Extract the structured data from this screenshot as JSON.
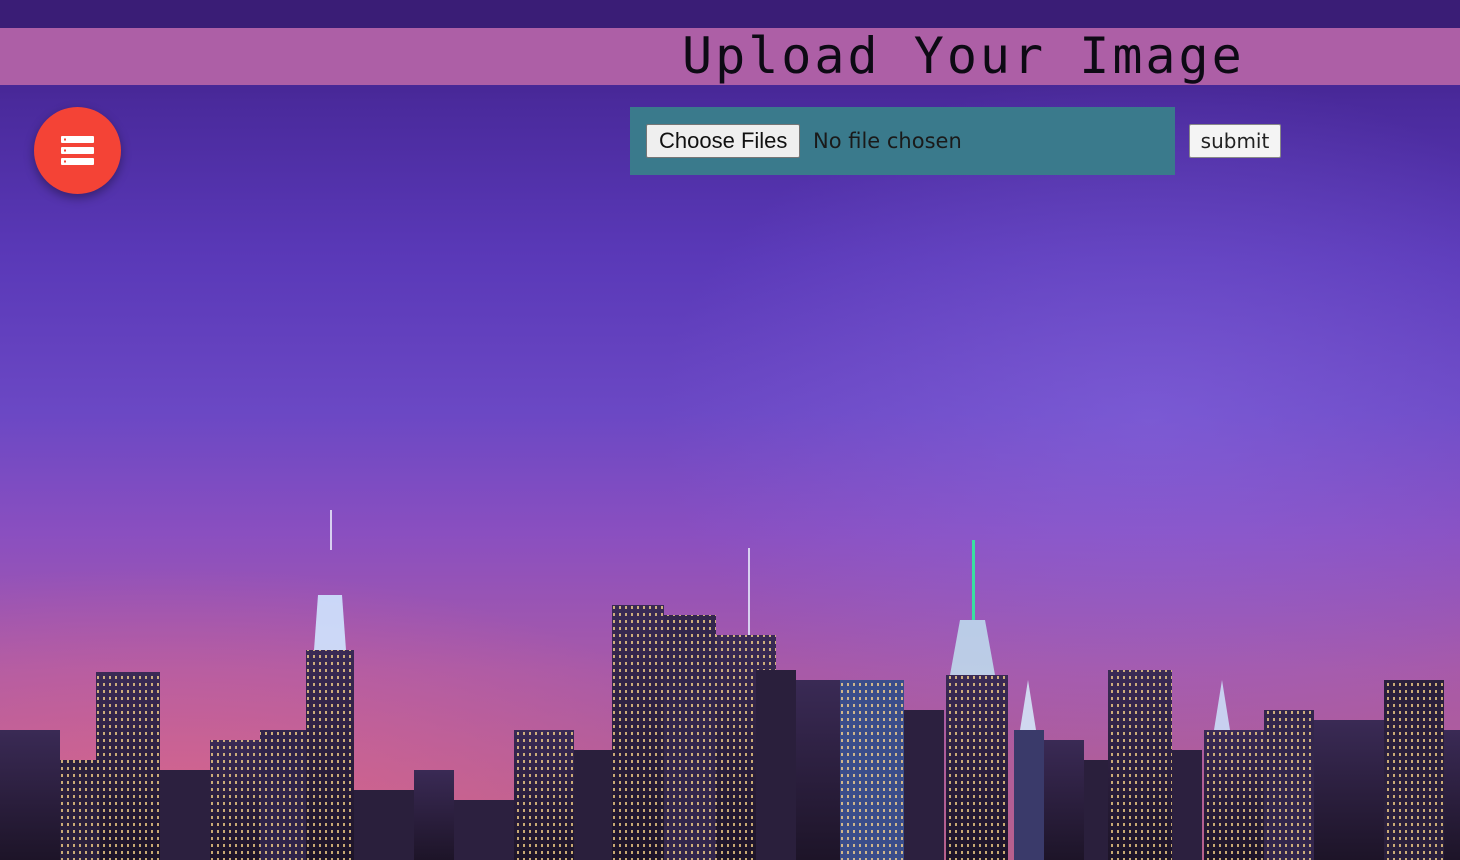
{
  "header": {
    "title": "Upload Your Image"
  },
  "menu_fab": {
    "icon": "list-icon",
    "color": "#f44336"
  },
  "upload": {
    "choose_label": "Choose Files",
    "file_status": "No file chosen",
    "submit_label": "submit"
  },
  "colors": {
    "header_bar": "#ad5fa6",
    "upload_box": "#3a7a8c",
    "top_strip": "#3a1d76"
  },
  "background": {
    "description_icon": "city-skyline-photo"
  }
}
